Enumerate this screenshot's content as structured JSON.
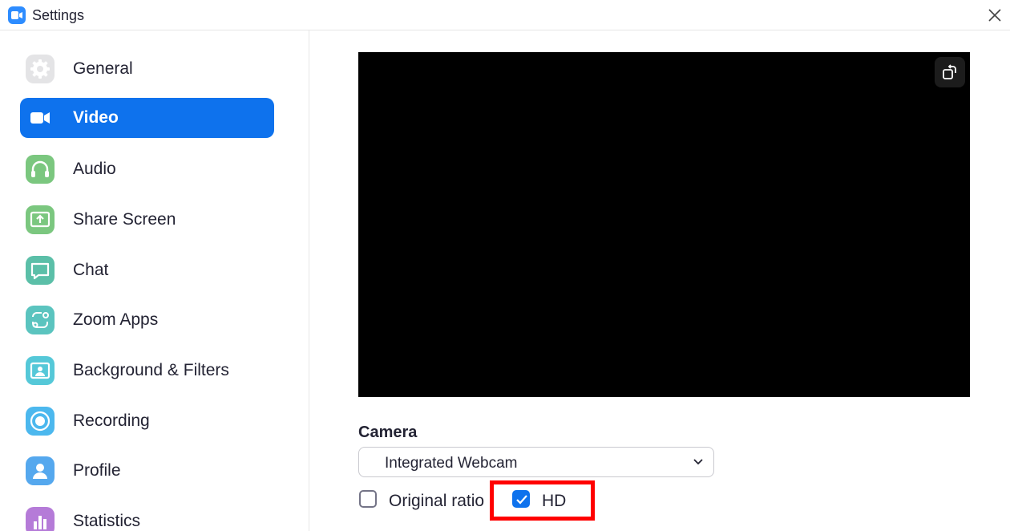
{
  "window": {
    "title": "Settings",
    "logo_icon": "zoom-camera-icon",
    "close_icon": "close-icon"
  },
  "sidebar": {
    "active_color": "#0e72ed",
    "items": [
      {
        "id": "general",
        "label": "General",
        "icon": "gear-icon",
        "color": "#e4e4e6",
        "active": false
      },
      {
        "id": "video",
        "label": "Video",
        "icon": "video-camera-icon",
        "color": "#0e72ed",
        "active": true
      },
      {
        "id": "audio",
        "label": "Audio",
        "icon": "headphones-icon",
        "color": "#7bc77f",
        "active": false
      },
      {
        "id": "share-screen",
        "label": "Share Screen",
        "icon": "share-screen-icon",
        "color": "#7bc77f",
        "active": false
      },
      {
        "id": "chat",
        "label": "Chat",
        "icon": "chat-bubble-icon",
        "color": "#5bbfa8",
        "active": false
      },
      {
        "id": "zoom-apps",
        "label": "Zoom Apps",
        "icon": "apps-icon",
        "color": "#5bc4bf",
        "active": false
      },
      {
        "id": "background-filters",
        "label": "Background & Filters",
        "icon": "background-portrait-icon",
        "color": "#55c8d8",
        "active": false
      },
      {
        "id": "recording",
        "label": "Recording",
        "icon": "record-icon",
        "color": "#4cb8ee",
        "active": false
      },
      {
        "id": "profile",
        "label": "Profile",
        "icon": "person-icon",
        "color": "#55a8ee",
        "active": false
      },
      {
        "id": "statistics",
        "label": "Statistics",
        "icon": "bar-chart-icon",
        "color": "#b57bd8",
        "active": false
      }
    ]
  },
  "main": {
    "preview_icon": "rotate-camera-icon",
    "camera": {
      "heading": "Camera",
      "selected": "Integrated Webcam"
    },
    "options": {
      "original_ratio": {
        "label": "Original ratio",
        "checked": false
      },
      "hd": {
        "label": "HD",
        "checked": true
      }
    },
    "highlight_color": "#ff0000"
  }
}
